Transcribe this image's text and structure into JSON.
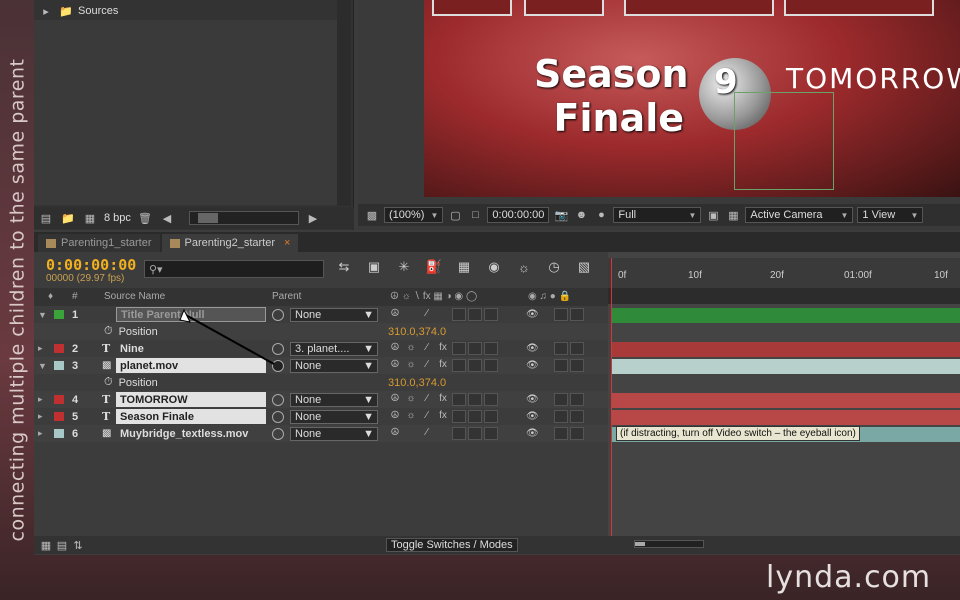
{
  "overlay": {
    "side_caption": "connecting multiple children to the same parent",
    "watermark": "lynda.com"
  },
  "project": {
    "folder": "Sources",
    "bpc": "8 bpc"
  },
  "viewer": {
    "zoom": "(100%)",
    "timecode": "0:00:00:00",
    "resolution": "Full",
    "camera": "Active Camera",
    "views": "1 View",
    "canvas_text": {
      "season": "Season",
      "finale": "Finale",
      "nine": "9",
      "tomorrow": "TOMORROW"
    }
  },
  "tabs": [
    {
      "label": "Parenting1_starter",
      "active": false
    },
    {
      "label": "Parenting2_starter",
      "active": true
    }
  ],
  "timeline": {
    "current_time": "0:00:00:00",
    "fps": "00000 (29.97 fps)",
    "search_placeholder": "",
    "headers": {
      "num": "#",
      "source": "Source Name",
      "parent": "Parent"
    },
    "ruler": [
      "0f",
      "10f",
      "20f",
      "01:00f",
      "10f"
    ],
    "tooltip": "(if distracting, turn off Video switch – the eyeball icon)",
    "toggle": "Toggle Switches / Modes",
    "layers": [
      {
        "num": "1",
        "type": "",
        "name": "Title Parent Null",
        "parent": "None",
        "label_color": "#3aa43a",
        "bar_color": "#2f8a3a",
        "ghost": true
      },
      {
        "kind": "prop",
        "name": "Position",
        "value": "310.0,374.0"
      },
      {
        "num": "2",
        "type": "T",
        "name": "Nine",
        "parent": "3. planet....",
        "label_color": "#c03030",
        "bar_color": "#a83a3a"
      },
      {
        "num": "3",
        "type": "img",
        "name": "planet.mov",
        "parent": "None",
        "label_color": "#a8c8c8",
        "bar_color": "#b8d0cc",
        "highlight": true
      },
      {
        "kind": "prop",
        "name": "Position",
        "value": "310.0,374.0"
      },
      {
        "num": "4",
        "type": "T",
        "name": "TOMORROW",
        "parent": "None",
        "label_color": "#c03030",
        "bar_color": "#b84848",
        "highlight": true
      },
      {
        "num": "5",
        "type": "T",
        "name": "Season Finale",
        "parent": "None",
        "label_color": "#c03030",
        "bar_color": "#b84848",
        "highlight": true
      },
      {
        "num": "6",
        "type": "img",
        "name": "Muybridge_textless.mov",
        "parent": "None",
        "label_color": "#a8c8c8",
        "bar_color": "#7aa8a4"
      }
    ]
  }
}
